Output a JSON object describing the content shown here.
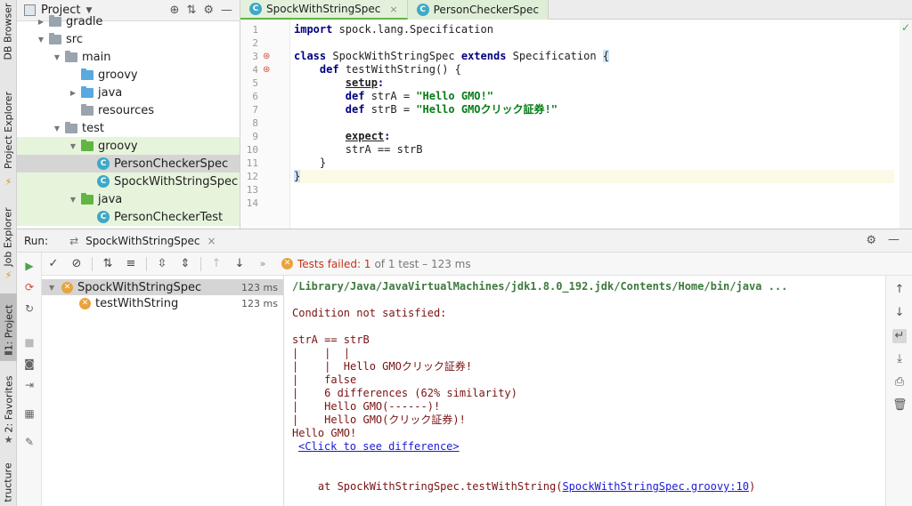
{
  "left_stripe": {
    "db_browser": "DB Browser",
    "project_explorer": "Project Explorer",
    "job_explorer": "Job Explorer",
    "project": "1: Project",
    "favorites": "2: Favorites",
    "structure": "tructure"
  },
  "project_panel": {
    "title": "Project",
    "tree": [
      {
        "label": "gradle",
        "kind": "folder-gray",
        "indent": 1,
        "arrow": "▶"
      },
      {
        "label": "src",
        "kind": "folder-gray",
        "indent": 1,
        "arrow": "▼"
      },
      {
        "label": "main",
        "kind": "folder-gray",
        "indent": 2,
        "arrow": "▼"
      },
      {
        "label": "groovy",
        "kind": "folder-blue",
        "indent": 3,
        "arrow": ""
      },
      {
        "label": "java",
        "kind": "folder-blue",
        "indent": 3,
        "arrow": "▶"
      },
      {
        "label": "resources",
        "kind": "folder-res",
        "indent": 3,
        "arrow": ""
      },
      {
        "label": "test",
        "kind": "folder-gray",
        "indent": 2,
        "arrow": "▼"
      },
      {
        "label": "groovy",
        "kind": "folder-green",
        "indent": 3,
        "arrow": "▼"
      },
      {
        "label": "PersonCheckerSpec",
        "kind": "class",
        "indent": 4,
        "arrow": ""
      },
      {
        "label": "SpockWithStringSpec",
        "kind": "class",
        "indent": 4,
        "arrow": ""
      },
      {
        "label": "java",
        "kind": "folder-green",
        "indent": 3,
        "arrow": "▼"
      },
      {
        "label": "PersonCheckerTest",
        "kind": "class",
        "indent": 4,
        "arrow": ""
      }
    ]
  },
  "editor": {
    "tabs": [
      {
        "label": "SpockWithStringSpec",
        "close": "×"
      },
      {
        "label": "PersonCheckerSpec",
        "close": "×"
      }
    ],
    "line_numbers": [
      "1",
      "2",
      "3",
      "4",
      "5",
      "6",
      "7",
      "8",
      "9",
      "10",
      "11",
      "12",
      "13",
      "14"
    ],
    "code": {
      "l1_kw": "import",
      "l1_rest": " spock.lang.Specification",
      "l3_kw1": "class",
      "l3_name": " SpockWithStringSpec ",
      "l3_kw2": "extends",
      "l3_rest": " Specification ",
      "l3_brace": "{",
      "l4_kw": "def",
      "l4_rest": " testWithString() {",
      "l5_label": "setup",
      "l5_colon": ":",
      "l6_kw": "def",
      "l6_mid": " strA = ",
      "l6_str": "\"Hello GMO!\"",
      "l7_kw": "def",
      "l7_mid": " strB = ",
      "l7_str": "\"Hello GMOクリック証券!\"",
      "l9_label": "expect",
      "l9_colon": ":",
      "l10": "strA == strB",
      "l11": "}",
      "l12": "}"
    }
  },
  "run": {
    "label": "Run:",
    "tab_label": "SpockWithStringSpec",
    "status_failed": "Tests failed: 1",
    "status_rest": "of 1 test – 123 ms",
    "tests": [
      {
        "label": "SpockWithStringSpec",
        "time": "123 ms"
      },
      {
        "label": "testWithString",
        "time": "123 ms"
      }
    ],
    "console": {
      "path": "/Library/Java/JavaVirtualMachines/jdk1.8.0_192.jdk/Contents/Home/bin/java ...",
      "l2": "Condition not satisfied:",
      "l3": "strA == strB",
      "l4": "|    |  |",
      "l5": "|    |  Hello GMOクリック証券!",
      "l6": "|    false",
      "l7": "|    6 differences (62% similarity)",
      "l8": "|    Hello GMO(------)!",
      "l9": "|    Hello GMO(クリック証券)!",
      "l10": "Hello GMO!",
      "link": "<Click to see difference>",
      "stack_prefix": "    at SpockWithStringSpec.testWithString(",
      "stack_link": "SpockWithStringSpec.groovy:10",
      "stack_suffix": ")"
    }
  },
  "colors": {
    "string": "#067d17",
    "keyword": "#000080",
    "console_text": "#7a1212",
    "fail": "#c2331c",
    "green_tab": "#e3f1dc"
  }
}
